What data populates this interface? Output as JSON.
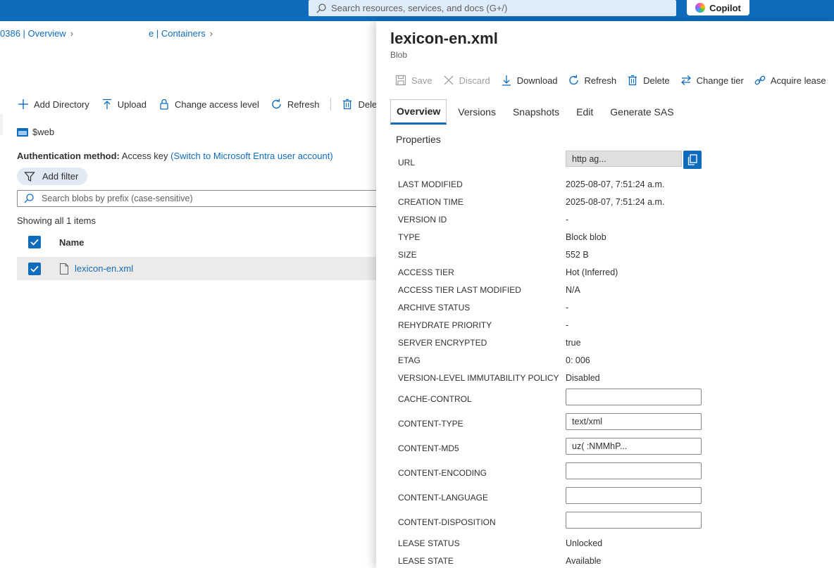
{
  "topbar": {
    "search_placeholder": "Search resources, services, and docs (G+/)",
    "copilot_label": "Copilot"
  },
  "breadcrumb": {
    "item1": "0386 | Overview",
    "item2": "e | Containers"
  },
  "left_toolbar": {
    "add_directory": "Add Directory",
    "upload": "Upload",
    "change_access_level": "Change access level",
    "refresh": "Refresh",
    "delete": "Dele"
  },
  "container": {
    "name": "$web"
  },
  "auth": {
    "label": "Authentication method:",
    "value": "Access key",
    "switch_link": "(Switch to Microsoft Entra user account)"
  },
  "filter": {
    "label": "Add filter"
  },
  "blob_search": {
    "placeholder": "Search blobs by prefix (case-sensitive)"
  },
  "list": {
    "showing": "Showing all 1 items",
    "column_name": "Name",
    "rows": [
      {
        "name": "lexicon-en.xml"
      }
    ]
  },
  "panel": {
    "title": "lexicon-en.xml",
    "subtitle": "Blob",
    "toolbar": {
      "save": "Save",
      "discard": "Discard",
      "download": "Download",
      "refresh": "Refresh",
      "delete": "Delete",
      "change_tier": "Change tier",
      "acquire_lease": "Acquire lease"
    },
    "tabs": [
      "Overview",
      "Versions",
      "Snapshots",
      "Edit",
      "Generate SAS"
    ],
    "properties_title": "Properties",
    "url_label": "URL",
    "url_value": "http                              ag...",
    "properties": [
      {
        "label": "LAST MODIFIED",
        "value": "2025-08-07, 7:51:24 a.m."
      },
      {
        "label": "CREATION TIME",
        "value": "2025-08-07, 7:51:24 a.m."
      },
      {
        "label": "VERSION ID",
        "value": "-"
      },
      {
        "label": "TYPE",
        "value": "Block blob"
      },
      {
        "label": "SIZE",
        "value": "552 B"
      },
      {
        "label": "ACCESS TIER",
        "value": "Hot (Inferred)"
      },
      {
        "label": "ACCESS TIER LAST MODIFIED",
        "value": "N/A"
      },
      {
        "label": "ARCHIVE STATUS",
        "value": "-"
      },
      {
        "label": "REHYDRATE PRIORITY",
        "value": "-"
      },
      {
        "label": "SERVER ENCRYPTED",
        "value": "true"
      },
      {
        "label": "ETAG",
        "value": "0:                                   006"
      },
      {
        "label": "VERSION-LEVEL IMMUTABILITY POLICY",
        "value": "Disabled"
      }
    ],
    "editable": [
      {
        "label": "CACHE-CONTROL",
        "value": ""
      },
      {
        "label": "CONTENT-TYPE",
        "value": "text/xml"
      },
      {
        "label": "CONTENT-MD5",
        "value": "uz(                             :NMMhP..."
      },
      {
        "label": "CONTENT-ENCODING",
        "value": ""
      },
      {
        "label": "CONTENT-LANGUAGE",
        "value": ""
      },
      {
        "label": "CONTENT-DISPOSITION",
        "value": ""
      }
    ],
    "lease": [
      {
        "label": "LEASE STATUS",
        "value": "Unlocked"
      },
      {
        "label": "LEASE STATE",
        "value": "Available"
      }
    ]
  }
}
